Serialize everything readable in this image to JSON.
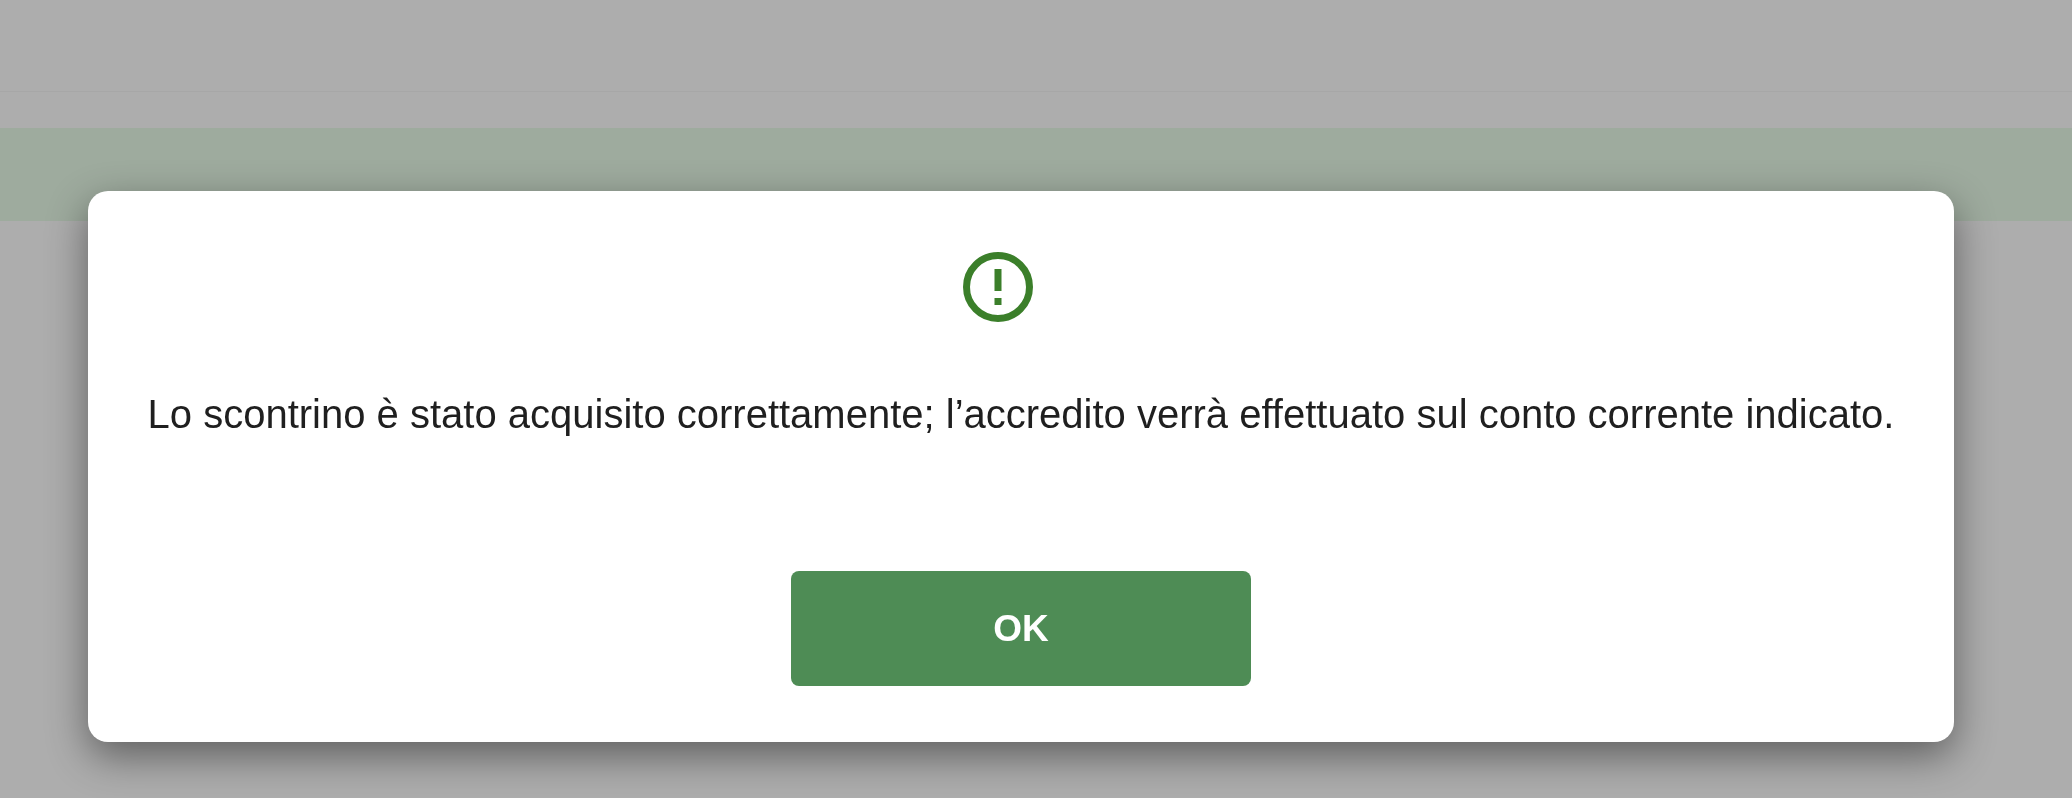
{
  "dialog": {
    "message": "Lo scontrino è stato acquisito correttamente; l’accredito verrà effettuato sul conto corrente indicato.",
    "button": "OK"
  }
}
